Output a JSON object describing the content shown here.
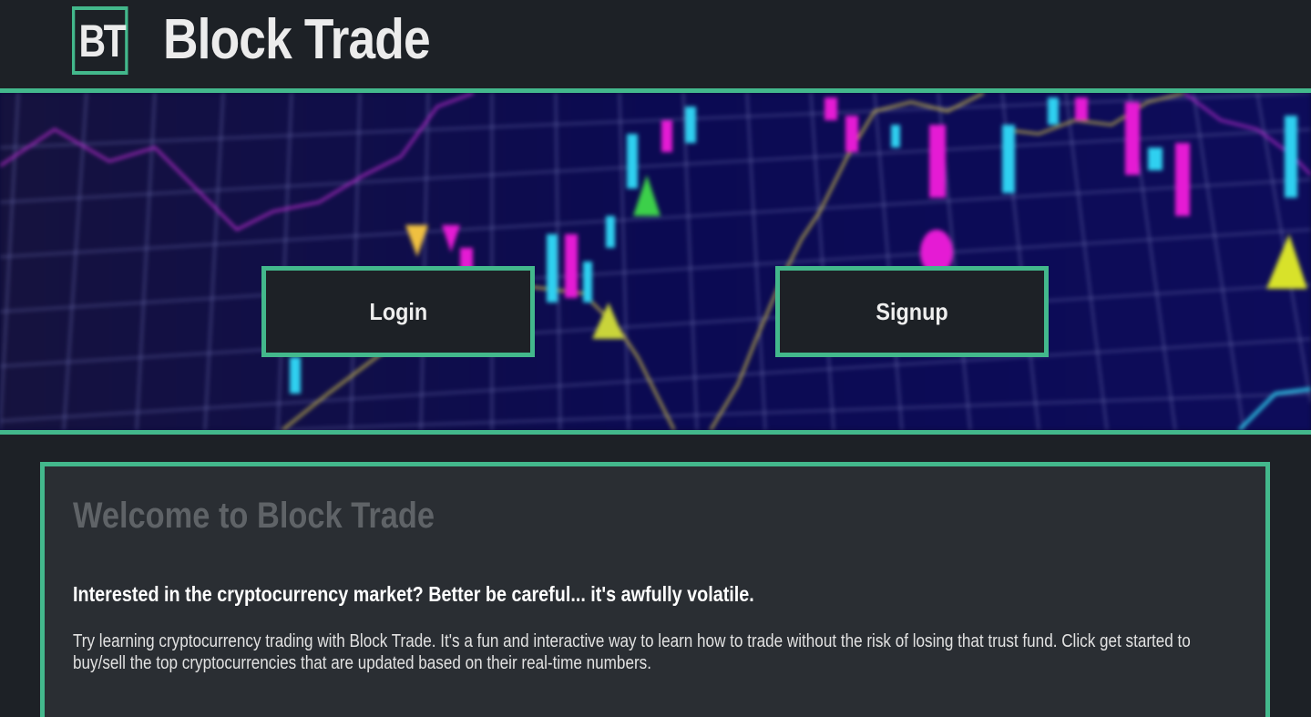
{
  "header": {
    "logo_text": "BT",
    "brand_name": "Block Trade"
  },
  "hero": {
    "background": "blurred-candlestick-chart-image",
    "login_label": "Login",
    "signup_label": "Signup"
  },
  "welcome": {
    "title": "Welcome to Block Trade",
    "subtitle": "Interested in the cryptocurrency market? Better be careful... it's awfully volatile.",
    "body": "Try learning cryptocurrency trading with Block Trade. It's a fun and interactive way to learn how to trade without the risk of losing that trust fund. Click get started to buy/sell the top cryptocurrencies that are updated based on their real-time numbers."
  },
  "colors": {
    "accent": "#43b88c",
    "background": "#1d2126",
    "panel": "#2a2e33",
    "title_muted": "#5f6367"
  }
}
